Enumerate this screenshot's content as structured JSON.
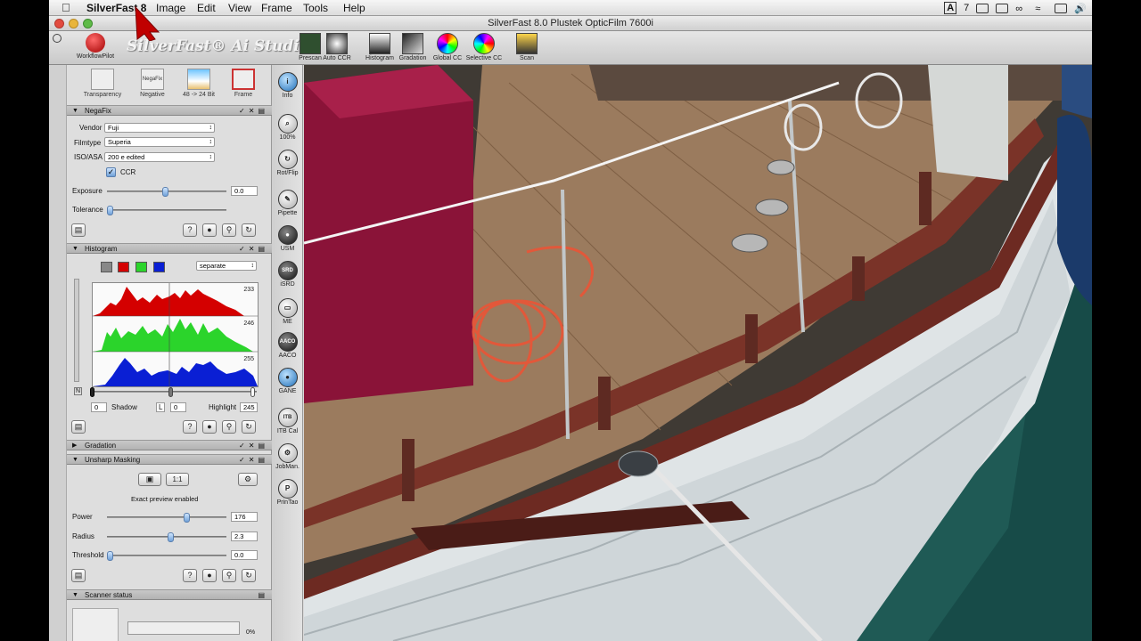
{
  "menubar": {
    "app_name": "SilverFast 8",
    "items": [
      "Image",
      "Edit",
      "View",
      "Frame",
      "Tools",
      "Help"
    ],
    "tray": {
      "input_menu": "A",
      "count": "7"
    }
  },
  "window": {
    "title": "SilverFast 8.0 Plustek OpticFilm 7600i"
  },
  "header": {
    "workflowpilot_label": "WorkflowPilot",
    "brand": "SilverFast® Ai Studio"
  },
  "toolbar": [
    {
      "label": "Prescan",
      "icon": "prescan-icon"
    },
    {
      "label": "Auto CCR",
      "icon": "auto-ccr-icon"
    },
    {
      "label": "Histogram",
      "icon": "histogram-icon"
    },
    {
      "label": "Gradation",
      "icon": "gradation-icon"
    },
    {
      "label": "Global CC",
      "icon": "color-wheel-icon"
    },
    {
      "label": "Selective CC",
      "icon": "selective-cc-icon"
    },
    {
      "label": "Scan",
      "icon": "scan-icon"
    }
  ],
  "modes": [
    {
      "label": "Transparency",
      "icon": "slide-icon"
    },
    {
      "label": "Negative",
      "icon": "negafix-icon",
      "icon_text": "NegaFix"
    },
    {
      "label": "48 -> 24 Bit",
      "icon": "palm-icon"
    },
    {
      "label": "Frame",
      "icon": "tools-icon"
    }
  ],
  "negafix": {
    "title": "NegaFix",
    "vendor_label": "Vendor",
    "vendor": "Fuji",
    "filmtype_label": "Filmtype",
    "filmtype": "Superia",
    "iso_label": "ISO/ASA",
    "iso": "200 e edited",
    "ccr_label": "CCR",
    "ccr_checked": true,
    "exposure_label": "Exposure",
    "exposure": "0.0",
    "tolerance_label": "Tolerance"
  },
  "histogram": {
    "title": "Histogram",
    "mode": "separate",
    "red_max": "233",
    "green_max": "246",
    "blue_max": "255",
    "shadow_label": "Shadow",
    "shadow": "0",
    "l_label": "L",
    "l_value": "0",
    "highlight_label": "Highlight",
    "highlight": "245",
    "n_label": "N"
  },
  "gradation": {
    "title": "Gradation"
  },
  "usm": {
    "title": "Unsharp Masking",
    "preview_label": "1:1",
    "exact_preview": "Exact preview enabled",
    "power_label": "Power",
    "power": "176",
    "radius_label": "Radius",
    "radius": "2.3",
    "threshold_label": "Threshold",
    "threshold": "0.0"
  },
  "scanner_status": {
    "title": "Scanner status",
    "progress": "0%",
    "progress_fraction": 0
  },
  "tools": [
    {
      "label": "Info",
      "glyph": "i"
    },
    {
      "label": "100%",
      "glyph": "⌕"
    },
    {
      "label": "Rot/Flip",
      "glyph": "↻"
    },
    {
      "label": "Pipette",
      "glyph": "✎"
    },
    {
      "label": "USM",
      "glyph": "●"
    },
    {
      "label": "iSRD",
      "glyph": "SRD"
    },
    {
      "label": "ME",
      "glyph": "▭"
    },
    {
      "label": "AACO",
      "glyph": "AACO"
    },
    {
      "label": "GANE",
      "glyph": "●"
    },
    {
      "label": "ITB Cal",
      "glyph": "ITB"
    },
    {
      "label": "JobMan.",
      "glyph": "⚙"
    },
    {
      "label": "PrinTao",
      "glyph": "P"
    }
  ],
  "colors": {
    "accent": "#6fa0d8",
    "red": "#d40000",
    "green": "#2bd42b",
    "blue": "#0a1fd4"
  }
}
